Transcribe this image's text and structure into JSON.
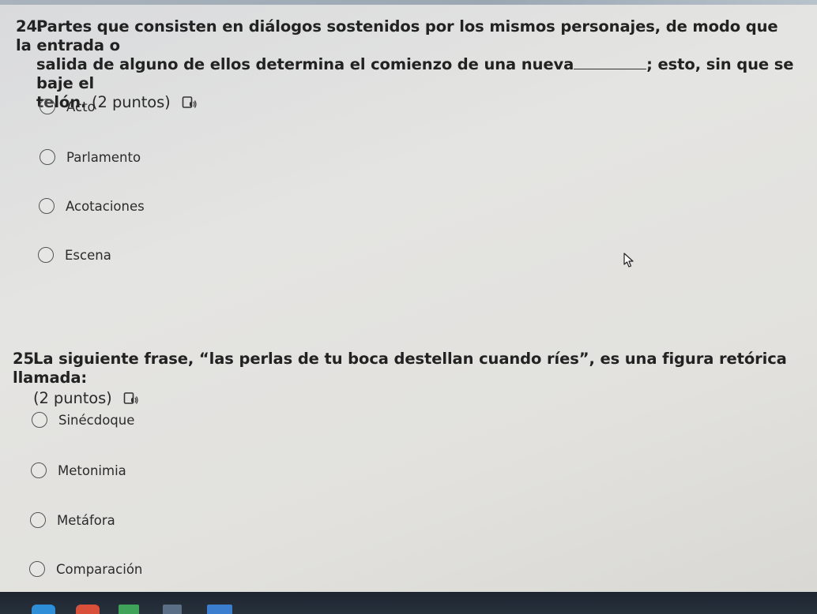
{
  "questions": [
    {
      "number": "24.",
      "text_line1": "Partes que consisten en diálogos sostenidos por los mismos personajes, de modo que la entrada o",
      "text_line2_a": "salida de alguno de ellos determina el comienzo de una nueva",
      "text_line2_b": "; esto, sin que se baje el",
      "text_line3": "telón.",
      "points": "(2 puntos)",
      "options": [
        "Acto",
        "Parlamento",
        "Acotaciones",
        "Escena"
      ]
    },
    {
      "number": "25.",
      "text_line1": "La siguiente frase, “las perlas de tu boca destellan cuando ríes”, es una figura retórica llamada:",
      "points": "(2 puntos)",
      "options": [
        "Sinécdoque",
        "Metonimia",
        "Metáfora",
        "Comparación"
      ]
    }
  ],
  "icons": {
    "reader": "immersive-reader-icon",
    "radio": "radio-button-icon",
    "cursor": "mouse-pointer-icon"
  },
  "colors": {
    "text": "#222222",
    "radio_border": "#555555",
    "taskbar": "#1d2530"
  }
}
